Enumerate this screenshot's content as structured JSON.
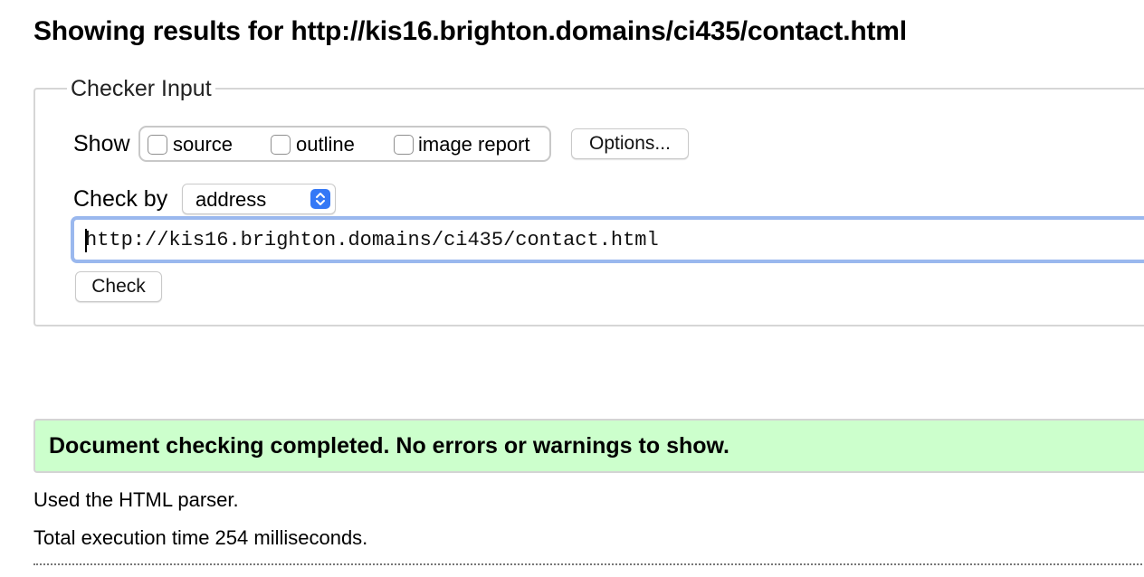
{
  "page_title": "Showing results for http://kis16.brighton.domains/ci435/contact.html",
  "checker": {
    "legend": "Checker Input",
    "show_label": "Show",
    "options": [
      {
        "label": "source",
        "checked": false
      },
      {
        "label": "outline",
        "checked": false
      },
      {
        "label": "image report",
        "checked": false
      }
    ],
    "options_button": "Options...",
    "check_by_label": "Check by",
    "check_by_value": "address",
    "url_value": "http://kis16.brighton.domains/ci435/contact.html",
    "check_button": "Check"
  },
  "result": {
    "message": "Document checking completed. No errors or warnings to show.",
    "color": "#ccffcc"
  },
  "info": {
    "parser": "Used the HTML parser.",
    "execution_time": "Total execution time 254 milliseconds."
  },
  "colors": {
    "focus_ring": "#9ab8ee",
    "select_accent": "#3478f6"
  },
  "icons": {
    "select_arrow": "chevron-up-down-icon"
  }
}
